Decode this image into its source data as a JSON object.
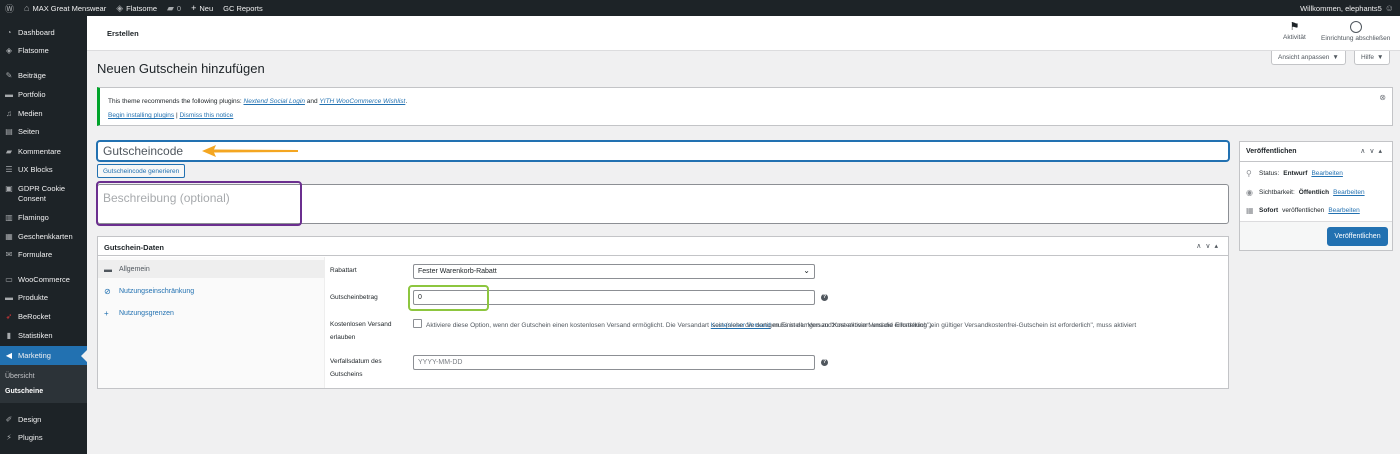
{
  "adminbar": {
    "site_name": "MAX Great Menswear",
    "theme": "Flatsome",
    "comments_count": "0",
    "new_label": "Neu",
    "reports": "GC Reports",
    "greeting": "Willkommen, elephants5"
  },
  "sidebar": {
    "items": [
      {
        "label": "Dashboard",
        "icon": "dashboard-icon"
      },
      {
        "label": "Flatsome",
        "icon": "flatsome-icon"
      },
      {
        "label": "Beiträge",
        "icon": "pin-icon"
      },
      {
        "label": "Portfolio",
        "icon": "portfolio-icon"
      },
      {
        "label": "Medien",
        "icon": "media-icon"
      },
      {
        "label": "Seiten",
        "icon": "page-icon"
      },
      {
        "label": "Kommentare",
        "icon": "comment-icon"
      },
      {
        "label": "UX Blocks",
        "icon": "blocks-icon"
      },
      {
        "label": "GDPR Cookie Consent",
        "icon": "lock-icon"
      },
      {
        "label": "Flamingo",
        "icon": "flamingo-icon"
      },
      {
        "label": "Geschenkkarten",
        "icon": "gift-card-icon"
      },
      {
        "label": "Formulare",
        "icon": "mail-icon"
      },
      {
        "label": "WooCommerce",
        "icon": "woo-icon"
      },
      {
        "label": "Produkte",
        "icon": "products-icon"
      },
      {
        "label": "BeRocket",
        "icon": "rocket-icon"
      },
      {
        "label": "Statistiken",
        "icon": "stats-icon"
      },
      {
        "label": "Marketing",
        "icon": "megaphone-icon"
      },
      {
        "label": "Design",
        "icon": "brush-icon"
      },
      {
        "label": "Plugins",
        "icon": "plug-icon"
      }
    ],
    "submenu": {
      "overview": "Übersicht",
      "coupons": "Gutscheine"
    }
  },
  "topbar": {
    "title": "Erstellen",
    "activity": "Aktivität",
    "setup": "Einrichtung abschließen"
  },
  "screen_options": {
    "view": "Ansicht anpassen",
    "help": "Hilfe"
  },
  "page_title": "Neuen Gutschein hinzufügen",
  "notice": {
    "prefix": "This theme recommends the following plugins:",
    "plugin1": "Nextend Social Login",
    "and": "and",
    "plugin2": "YITH WooCommerce Wishlist",
    "suffix": ".",
    "begin": "Begin installing plugins",
    "sep": "|",
    "dismiss": "Dismiss this notice"
  },
  "coupon": {
    "code_placeholder": "Gutscheincode",
    "generate": "Gutscheincode generieren",
    "description_placeholder": "Beschreibung (optional)"
  },
  "coupon_data": {
    "title": "Gutschein-Daten",
    "tabs": [
      "Allgemein",
      "Nutzungseinschränkung",
      "Nutzungsgrenzen"
    ],
    "discount_type_label": "Rabattart",
    "discount_type_value": "Fester Warenkorb-Rabatt",
    "amount_label": "Gutscheinbetrag",
    "amount_value": "0",
    "free_shipping_label_1": "Kostenlosen Versand",
    "free_shipping_label_2": "erlauben",
    "free_shipping_desc_1": "Aktiviere diese Option, wenn der Gutschein einen kostenlosen Versand ermöglicht. Die Versandart",
    "free_shipping_link": "Kostenloser Versand",
    "free_shipping_desc_2": "muss in der Versandzone aktiviert und die Einstellung „ein gültiger Versandkostenfrei-Gutschein ist erforderlich\", muss aktiviert",
    "free_shipping_desc_3": "sein (siehe die dortigen Einstellungen zu \"Kostenloser Versand erforderlich\").",
    "expiry_label_1": "Verfallsdatum des",
    "expiry_label_2": "Gutscheins",
    "expiry_placeholder": "YYYY-MM-DD"
  },
  "publish": {
    "title": "Veröffentlichen",
    "status_label": "Status:",
    "status_value": "Entwurf",
    "visibility_label": "Sichtbarkeit:",
    "visibility_value": "Öffentlich",
    "schedule_label": "Sofort",
    "schedule_suffix": "veröffentlichen",
    "edit": "Bearbeiten",
    "button": "Veröffentlichen"
  },
  "colors": {
    "admin_dark": "#1d2327",
    "accent": "#2271b1",
    "notice_green": "#00a32a",
    "annotation_orange": "#f4a621",
    "annotation_purple": "#6b2f8f",
    "annotation_green": "#8dc63f"
  }
}
